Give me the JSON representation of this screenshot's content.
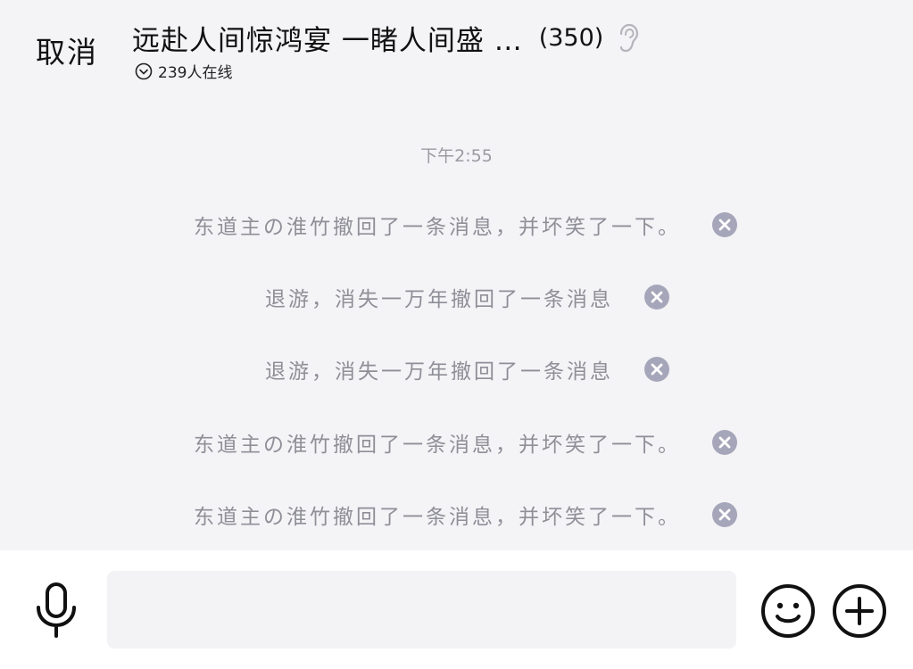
{
  "header": {
    "cancel_label": "取消",
    "group_title": "远赴人间惊鸿宴  一睹人间盛 …",
    "member_count": "(350)",
    "online_status": "239人在线"
  },
  "timestamp": "下午2:55",
  "notices": [
    {
      "text": "东道主の淮竹撤回了一条消息，并坏笑了一下。"
    },
    {
      "text": "退游，消失一万年撤回了一条消息"
    },
    {
      "text": "退游，消失一万年撤回了一条消息"
    },
    {
      "text": "东道主の淮竹撤回了一条消息，并坏笑了一下。"
    },
    {
      "text": "东道主の淮竹撤回了一条消息，并坏笑了一下。"
    }
  ],
  "input_bar": {
    "placeholder": ""
  },
  "icons": {
    "ear": "ear-icon",
    "online": "chevron-circle-icon",
    "dismiss": "close-circle-icon",
    "mic": "microphone-icon",
    "emoji": "smiley-icon",
    "plus": "plus-circle-icon"
  },
  "colors": {
    "background": "#f4f3f6",
    "notice_text": "#8f8f98",
    "dismiss_badge": "#a6a6ba",
    "input_bar": "#ffffff",
    "input_field": "#f3f3f5"
  }
}
